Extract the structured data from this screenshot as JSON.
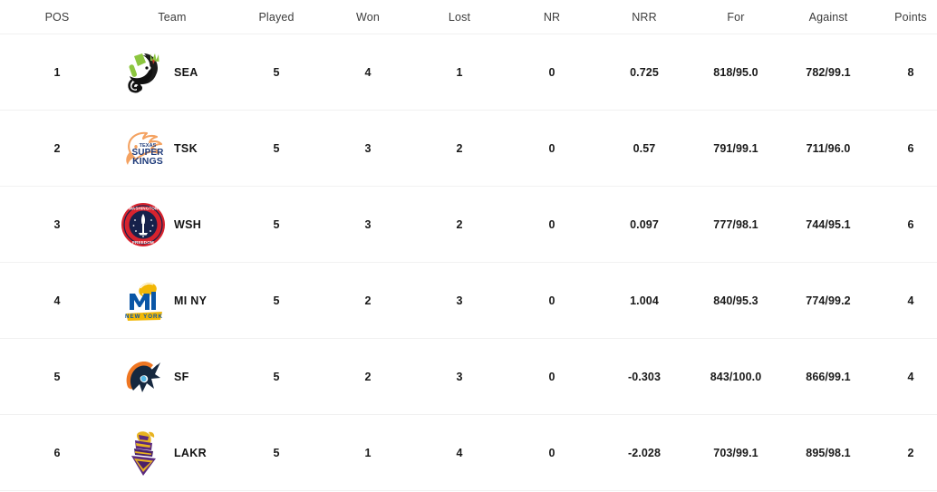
{
  "table": {
    "columns": [
      {
        "key": "pos",
        "label": "POS"
      },
      {
        "key": "team",
        "label": "Team"
      },
      {
        "key": "played",
        "label": "Played"
      },
      {
        "key": "won",
        "label": "Won"
      },
      {
        "key": "lost",
        "label": "Lost"
      },
      {
        "key": "nr",
        "label": "NR"
      },
      {
        "key": "nrr",
        "label": "NRR"
      },
      {
        "key": "for",
        "label": "For"
      },
      {
        "key": "against",
        "label": "Against"
      },
      {
        "key": "points",
        "label": "Points"
      }
    ],
    "rows": [
      {
        "pos": "1",
        "team": "SEA",
        "logo": "sea-orcas-logo",
        "played": "5",
        "won": "4",
        "lost": "1",
        "nr": "0",
        "nrr": "0.725",
        "for": "818/95.0",
        "against": "782/99.1",
        "points": "8"
      },
      {
        "pos": "2",
        "team": "TSK",
        "logo": "texas-super-kings-logo",
        "played": "5",
        "won": "3",
        "lost": "2",
        "nr": "0",
        "nrr": "0.57",
        "for": "791/99.1",
        "against": "711/96.0",
        "points": "6"
      },
      {
        "pos": "3",
        "team": "WSH",
        "logo": "washington-freedom-logo",
        "played": "5",
        "won": "3",
        "lost": "2",
        "nr": "0",
        "nrr": "0.097",
        "for": "777/98.1",
        "against": "744/95.1",
        "points": "6"
      },
      {
        "pos": "4",
        "team": "MI NY",
        "logo": "mi-new-york-logo",
        "played": "5",
        "won": "2",
        "lost": "3",
        "nr": "0",
        "nrr": "1.004",
        "for": "840/95.3",
        "against": "774/99.2",
        "points": "4"
      },
      {
        "pos": "5",
        "team": "SF",
        "logo": "san-francisco-unicorns-logo",
        "played": "5",
        "won": "2",
        "lost": "3",
        "nr": "0",
        "nrr": "-0.303",
        "for": "843/100.0",
        "against": "866/99.1",
        "points": "4"
      },
      {
        "pos": "6",
        "team": "LAKR",
        "logo": "la-knight-riders-logo",
        "played": "5",
        "won": "1",
        "lost": "4",
        "nr": "0",
        "nrr": "-2.028",
        "for": "703/99.1",
        "against": "895/98.1",
        "points": "2"
      }
    ]
  },
  "colors": {
    "page_background": "#ffffff",
    "header_text": "#3c3c3c",
    "cell_text": "#1a1a1a",
    "row_divider": "#f1f1f1",
    "sea_green": "#8cc63f",
    "sea_black": "#111111",
    "tsk_orange": "#f4a261",
    "tsk_navy": "#1d3a7a",
    "wsh_red": "#d7232e",
    "wsh_navy": "#16214b",
    "mi_blue": "#0a56a6",
    "mi_gold": "#f2b705",
    "sf_orange": "#ef7622",
    "sf_navy": "#16283f",
    "lakr_purple": "#5b2a7e",
    "lakr_gold": "#e8b320"
  }
}
